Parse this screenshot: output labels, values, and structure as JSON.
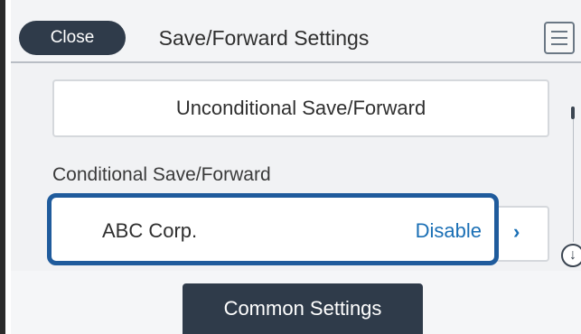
{
  "header": {
    "close_label": "Close",
    "title": "Save/Forward Settings",
    "menu_icon": "menu-list-icon"
  },
  "main": {
    "unconditional_label": "Unconditional Save/Forward",
    "conditional_section_label": "Conditional Save/Forward",
    "entries": [
      {
        "name": "ABC Corp.",
        "status": "Disable"
      }
    ],
    "accent_color": "#1a6fb5",
    "selection_color": "#1f5b9c"
  },
  "footer": {
    "common_settings_label": "Common Settings"
  }
}
